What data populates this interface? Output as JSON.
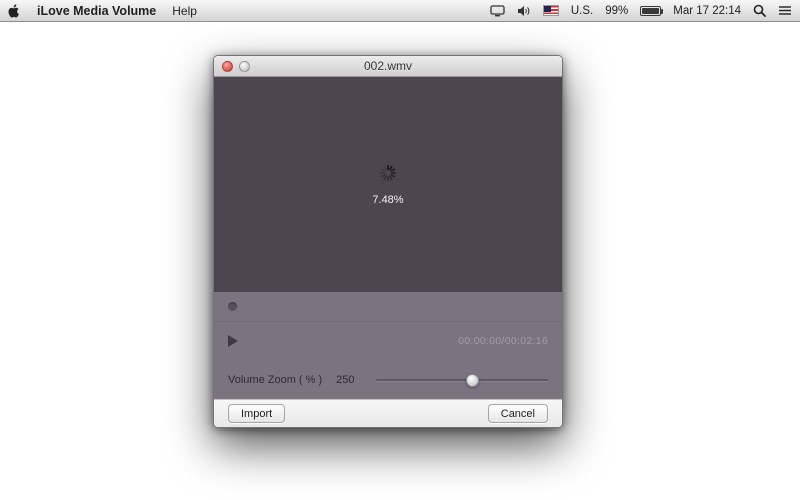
{
  "menu_bar": {
    "app_name": "iLove Media Volume",
    "menus": [
      "Help"
    ],
    "status": {
      "input_source": "U.S.",
      "battery_percent": "99%",
      "clock": "Mar 17 22:14"
    }
  },
  "window": {
    "title": "002.wmv",
    "video": {
      "progress": "7.48%"
    },
    "controls": {
      "time": "00:00:00/00:02:16",
      "volume_zoom_label": "Volume Zoom ( % )",
      "volume_zoom_value": "250"
    },
    "footer": {
      "import_label": "Import",
      "cancel_label": "Cancel"
    }
  },
  "icons": {
    "apple": "apple-logo",
    "display": "display-icon",
    "volume": "speaker-icon",
    "flag": "us-flag-icon",
    "battery": "battery-icon",
    "spotlight": "magnifier-icon",
    "notification_center": "list-icon",
    "play": "play-triangle",
    "spinner": "loading-spinner"
  },
  "colors": {
    "video_bg": "#4b4650",
    "controls_bg": "#7b7380",
    "close_button": "#e0544c",
    "wallpaper_base": "#0b1b33"
  }
}
